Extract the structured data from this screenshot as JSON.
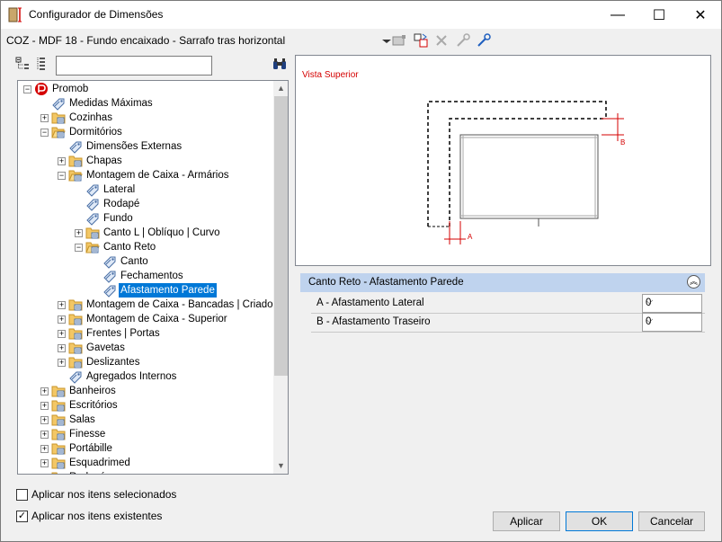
{
  "window": {
    "title": "Configurador de Dimensões",
    "minimize_glyph": "—",
    "maximize_glyph": "☐",
    "close_glyph": "✕"
  },
  "header": {
    "item_title": "COZ - MDF 18 - Fundo encaixado - Sarrafo tras horizontal"
  },
  "search": {
    "value": ""
  },
  "tree": {
    "nodes": [
      {
        "label": "Promob"
      },
      {
        "label": "Medidas Máximas"
      },
      {
        "label": "Cozinhas"
      },
      {
        "label": "Dormitórios"
      },
      {
        "label": "Dimensões Externas"
      },
      {
        "label": "Chapas"
      },
      {
        "label": "Montagem de Caixa - Armários"
      },
      {
        "label": "Lateral"
      },
      {
        "label": "Rodapé"
      },
      {
        "label": "Fundo"
      },
      {
        "label": "Canto L | Oblíquo | Curvo"
      },
      {
        "label": "Canto Reto"
      },
      {
        "label": "Canto"
      },
      {
        "label": "Fechamentos"
      },
      {
        "label": "Afastamento Parede"
      },
      {
        "label": "Montagem de Caixa - Bancadas | Criados"
      },
      {
        "label": "Montagem de Caixa - Superior"
      },
      {
        "label": "Frentes | Portas"
      },
      {
        "label": "Gavetas"
      },
      {
        "label": "Deslizantes"
      },
      {
        "label": "Agregados Internos"
      },
      {
        "label": "Banheiros"
      },
      {
        "label": "Escritórios"
      },
      {
        "label": "Salas"
      },
      {
        "label": "Finesse"
      },
      {
        "label": "Portábille"
      },
      {
        "label": "Esquadrimed"
      },
      {
        "label": "Rodapé"
      }
    ]
  },
  "preview": {
    "view_label": "Vista Superior",
    "dim_a": "A",
    "dim_b": "B"
  },
  "properties": {
    "section_title": "Canto Reto - Afastamento Parede",
    "rows": [
      {
        "name": "A - Afastamento Lateral",
        "value": "0"
      },
      {
        "name": "B - Afastamento Traseiro",
        "value": "0"
      }
    ]
  },
  "options": {
    "apply_selected": "Aplicar nos itens selecionados",
    "apply_existing": "Aplicar nos itens existentes",
    "apply_selected_checked": false,
    "apply_existing_checked": true
  },
  "buttons": {
    "apply": "Aplicar",
    "ok": "OK",
    "cancel": "Cancelar"
  },
  "colors": {
    "selection": "#0078d7",
    "section_header": "#bfd3ee",
    "annotation_red": "#d40000"
  }
}
